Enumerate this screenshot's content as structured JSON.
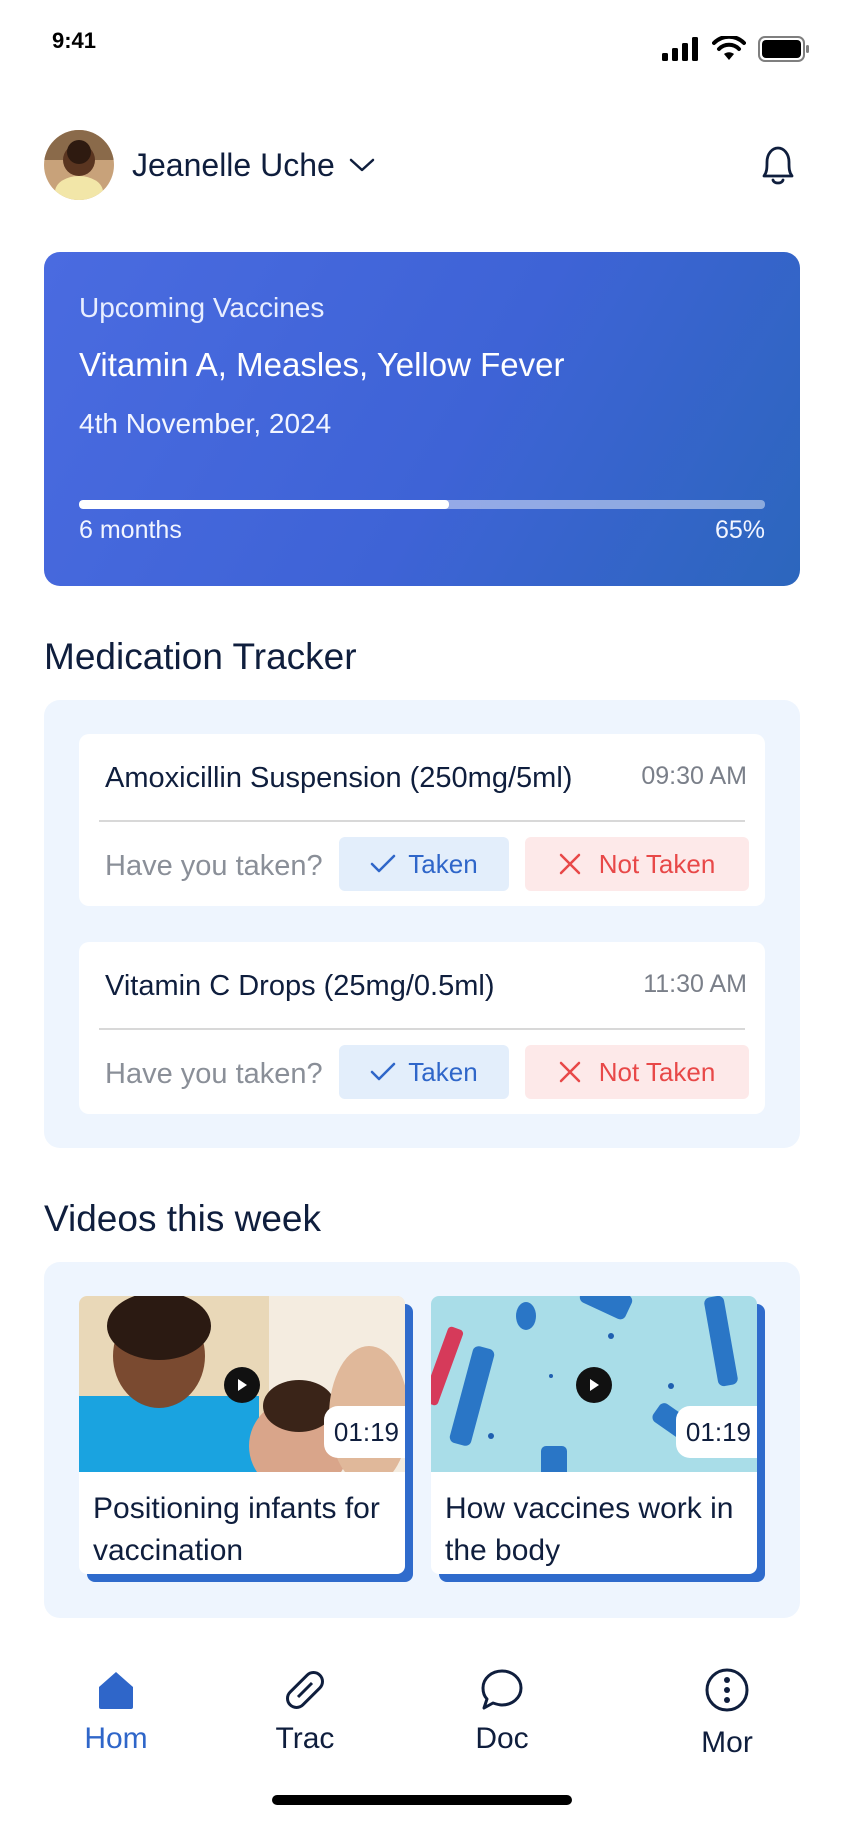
{
  "status_bar": {
    "time": "9:41"
  },
  "header": {
    "user_name": "Jeanelle Uche"
  },
  "vaccine_card": {
    "label": "Upcoming Vaccines",
    "vaccines": "Vitamin A, Measles, Yellow Fever",
    "date": "4th November, 2024",
    "progress_fraction": 0.54,
    "months_label": "6 months",
    "percent_label": "65%"
  },
  "medication": {
    "title": "Medication Tracker",
    "items": [
      {
        "name": "Amoxicillin Suspension (250mg/5ml)",
        "time": "09:30 AM",
        "question": "Have you taken?",
        "taken_label": "Taken",
        "not_taken_label": "Not Taken"
      },
      {
        "name": "Vitamin C Drops (25mg/0.5ml)",
        "time": "11:30 AM",
        "question": "Have you taken?",
        "taken_label": "Taken",
        "not_taken_label": "Not Taken"
      }
    ]
  },
  "videos": {
    "title": "Videos this week",
    "items": [
      {
        "title": "Positioning infants for vaccination",
        "duration": "01:19"
      },
      {
        "title": "How vaccines work in the body",
        "duration": "01:19"
      }
    ]
  },
  "nav": {
    "items": [
      {
        "label": "Hom",
        "icon": "home-icon",
        "active": true
      },
      {
        "label": "Trac",
        "icon": "pill-icon",
        "active": false
      },
      {
        "label": "Doc",
        "icon": "chat-bubble-icon",
        "active": false
      },
      {
        "label": "Mor",
        "icon": "more-icon",
        "active": false
      }
    ]
  },
  "colors": {
    "primary": "#2f66c9",
    "navy": "#0f1e3d",
    "danger": "#e84848",
    "panel_bg": "#eef5fe"
  }
}
